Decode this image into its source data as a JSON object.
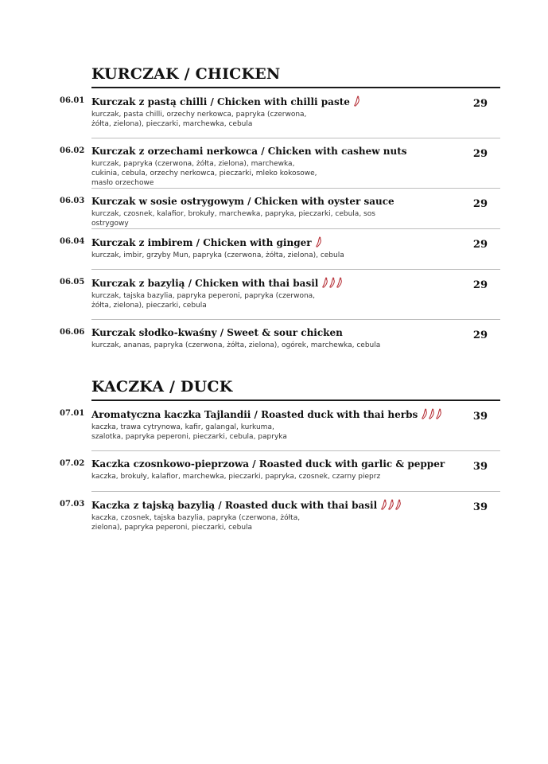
{
  "sections": [
    {
      "title": "KURCZAK / CHICKEN",
      "items": [
        {
          "num": "06.01",
          "title": "Kurczak z pastą chilli / Chicken with chilli paste",
          "desc": "kurczak, pasta chilli, orzechy nerkowca, papryka (czerwona, żółta, zielona), pieczarki, marchewka, cebula",
          "price": "29",
          "spice": 1
        },
        {
          "num": "06.02",
          "title": "Kurczak z orzechami nerkowca / Chicken with cashew nuts",
          "desc": "kurczak, papryka (czerwona, żółta, zielona), marchewka, cukinia, cebula, orzechy nerkowca, pieczarki, mleko kokosowe, masło orzechowe",
          "price": "29",
          "spice": 0
        },
        {
          "num": "06.03",
          "title": "Kurczak w sosie ostrygowym / Chicken with oyster sauce",
          "desc": "kurczak, czosnek, kalafior, brokuły, marchewka, papryka, pieczarki, cebula, sos ostrygowy",
          "price": "29",
          "spice": 0
        },
        {
          "num": "06.04",
          "title": "Kurczak z imbirem / Chicken with ginger",
          "desc": "kurczak, imbir, grzyby Mun, papryka (czerwona, żółta, zielona), cebula",
          "price": "29",
          "spice": 1
        },
        {
          "num": "06.05",
          "title": "Kurczak z bazylią / Chicken with thai basil",
          "desc": "kurczak, tajska bazylia, papryka peperoni, papryka (czerwona, żółta, zielona), pieczarki, cebula",
          "price": "29",
          "spice": 3
        },
        {
          "num": "06.06",
          "title": "Kurczak słodko-kwaśny / Sweet & sour chicken",
          "desc": "kurczak, ananas, papryka (czerwona, żółta, zielona), ogórek, marchewka, cebula",
          "price": "29",
          "spice": 0
        }
      ]
    },
    {
      "title": "KACZKA / DUCK",
      "items": [
        {
          "num": "07.01",
          "title": "Aromatyczna kaczka Tajlandii / Roasted duck with thai herbs",
          "desc": "kaczka, trawa cytrynowa, kafir, galangal, kurkuma, szalotka, papryka peperoni, pieczarki, cebula, papryka",
          "price": "39",
          "spice": 3
        },
        {
          "num": "07.02",
          "title": "Kaczka czosnkowo-pieprzowa / Roasted duck with garlic & pepper",
          "desc": "kaczka, brokuły, kalafior, marchewka, pieczarki, papryka, czosnek, czarny pieprz",
          "price": "39",
          "spice": 0
        },
        {
          "num": "07.03",
          "title": "Kaczka z tajską bazylią / Roasted duck with thai basil",
          "desc": "kaczka, czosnek, tajska bazylia, papryka (czerwona, żółta, zielona), papryka peperoni, pieczarki, cebula",
          "price": "39",
          "spice": 3
        }
      ]
    }
  ],
  "icons": {
    "spice": "chili-pepper-icon"
  },
  "colors": {
    "chili": "#b3262e",
    "text": "#1a1a1a",
    "divider": "#bdbdbd"
  }
}
